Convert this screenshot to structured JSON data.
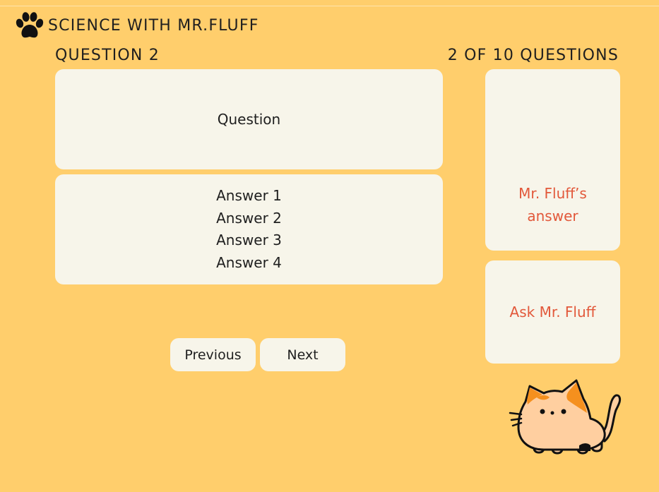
{
  "header": {
    "logo_icon": "paw-icon",
    "app_title": "SCIENCE WITH MR.FLUFF"
  },
  "quiz": {
    "question_label": "QUESTION 2",
    "progress_text": "2 OF 10 QUESTIONS",
    "question_text": "Question",
    "answers": [
      "Answer 1",
      "Answer 2",
      "Answer 3",
      "Answer 4"
    ]
  },
  "sidebar": {
    "fluff_answer_text": "Mr. Fluff’s answer",
    "ask_button_label": "Ask Mr. Fluff",
    "mascot_icon": "cat-mascot-icon"
  },
  "navigation": {
    "previous_label": "Previous",
    "next_label": "Next"
  },
  "colors": {
    "background": "#FFCE6C",
    "card": "#F7F5EA",
    "accent_text": "#E2583A",
    "text": "#1F1F1F"
  }
}
